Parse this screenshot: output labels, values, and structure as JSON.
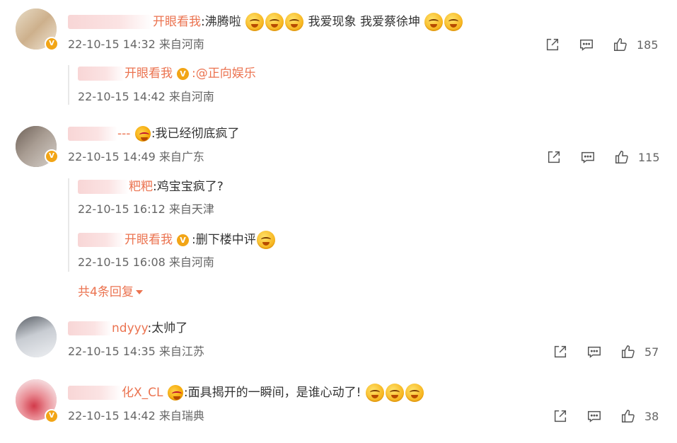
{
  "comments": [
    {
      "name_visible": "开眼看我",
      "text": "沸腾啦",
      "text_after": "我爱现象 我爱蔡徐坤",
      "meta": "22-10-15 14:32 来自河南",
      "likes": "185",
      "replies": [
        {
          "name_visible": "开眼看我",
          "text": ":@正向娱乐",
          "meta": "22-10-15 14:42 来自河南"
        }
      ]
    },
    {
      "name_visible": "---",
      "text": ":我已经彻底疯了",
      "meta": "22-10-15 14:49 来自广东",
      "likes": "115",
      "replies": [
        {
          "name_visible": "粑粑",
          "text": ":鸡宝宝疯了?",
          "meta": "22-10-15 16:12 来自天津"
        },
        {
          "name_visible": "开眼看我",
          "text": ":删下楼中评",
          "meta": "22-10-15 16:08 来自河南"
        }
      ],
      "more_label": "共4条回复"
    },
    {
      "name_visible": "ndyyy",
      "text": ":太帅了",
      "meta": "22-10-15 14:35 来自江苏",
      "likes": "57"
    },
    {
      "name_visible": "化X_CL",
      "text": ":面具揭开的一瞬间，是谁心动了!",
      "meta": "22-10-15 14:42 来自瑞典",
      "likes": "38"
    }
  ],
  "icons": {
    "share": "share-icon",
    "comment": "comment-icon",
    "like": "thumbs-up-icon",
    "verified": "verified-badge-icon"
  },
  "colors": {
    "username": "#eb7350",
    "meta": "#666666",
    "badge": "#f2a516"
  }
}
